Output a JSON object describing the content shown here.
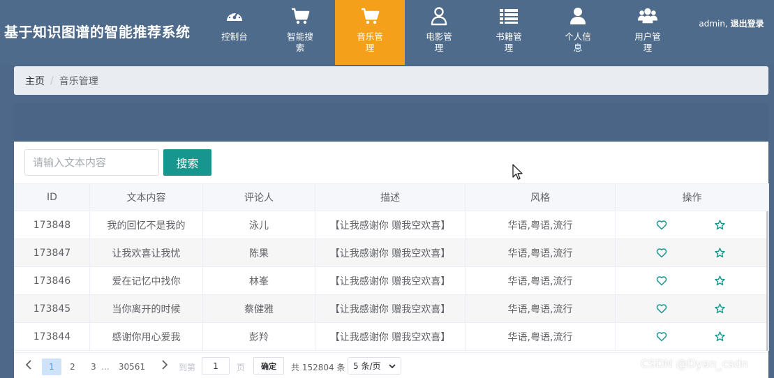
{
  "app": {
    "title": "基于知识图谱的智能推荐系统"
  },
  "nav": {
    "items": [
      {
        "label": "控制台",
        "icon": "dashboard-icon"
      },
      {
        "label": "智能搜索",
        "icon": "cart-icon"
      },
      {
        "label": "音乐管理",
        "icon": "cart-icon",
        "active": true
      },
      {
        "label": "电影管理",
        "icon": "user-outline-icon"
      },
      {
        "label": "书籍管理",
        "icon": "list-icon"
      },
      {
        "label": "个人信息",
        "icon": "user-icon"
      },
      {
        "label": "用户管理",
        "icon": "users-icon"
      }
    ],
    "active_color": "#f5a01a",
    "bar_color": "#4e6b8b"
  },
  "user": {
    "name": "admin,",
    "logout": "退出登录"
  },
  "breadcrumb": {
    "home": "主页",
    "separator": "/",
    "current": "音乐管理"
  },
  "search": {
    "placeholder": "请输入文本内容",
    "value": "",
    "button": "搜索",
    "button_color": "#16968e"
  },
  "table": {
    "columns": [
      "ID",
      "文本内容",
      "评论人",
      "描述",
      "风格",
      "操作"
    ],
    "rows": [
      {
        "id": "173848",
        "text": "我的回忆不是我的",
        "reviewer": "泳儿",
        "desc": "【让我感谢你 赠我空欢喜】",
        "style": "华语,粤语,流行"
      },
      {
        "id": "173847",
        "text": "让我欢喜让我忧",
        "reviewer": "陈果",
        "desc": "【让我感谢你 赠我空欢喜】",
        "style": "华语,粤语,流行"
      },
      {
        "id": "173846",
        "text": "爱在记忆中找你",
        "reviewer": "林峯",
        "desc": "【让我感谢你 赠我空欢喜】",
        "style": "华语,粤语,流行"
      },
      {
        "id": "173845",
        "text": "当你离开的时候",
        "reviewer": "蔡健雅",
        "desc": "【让我感谢你 赠我空欢喜】",
        "style": "华语,粤语,流行"
      },
      {
        "id": "173844",
        "text": "感谢你用心爱我",
        "reviewer": "彭羚",
        "desc": "【让我感谢你 赠我空欢喜】",
        "style": "华语,粤语,流行"
      }
    ],
    "row_actions": [
      "heart-icon",
      "star-icon"
    ],
    "action_color": "#16968e"
  },
  "pagination": {
    "pages": [
      "1",
      "2",
      "3",
      "...",
      "30561"
    ],
    "active_page": "1",
    "goto_label": "到第",
    "goto_value": "1",
    "page_label": "页",
    "confirm": "确定",
    "total": "共 152804 条",
    "page_size": "5 条/页"
  },
  "watermark": "CSDN @Dyan_csdn"
}
